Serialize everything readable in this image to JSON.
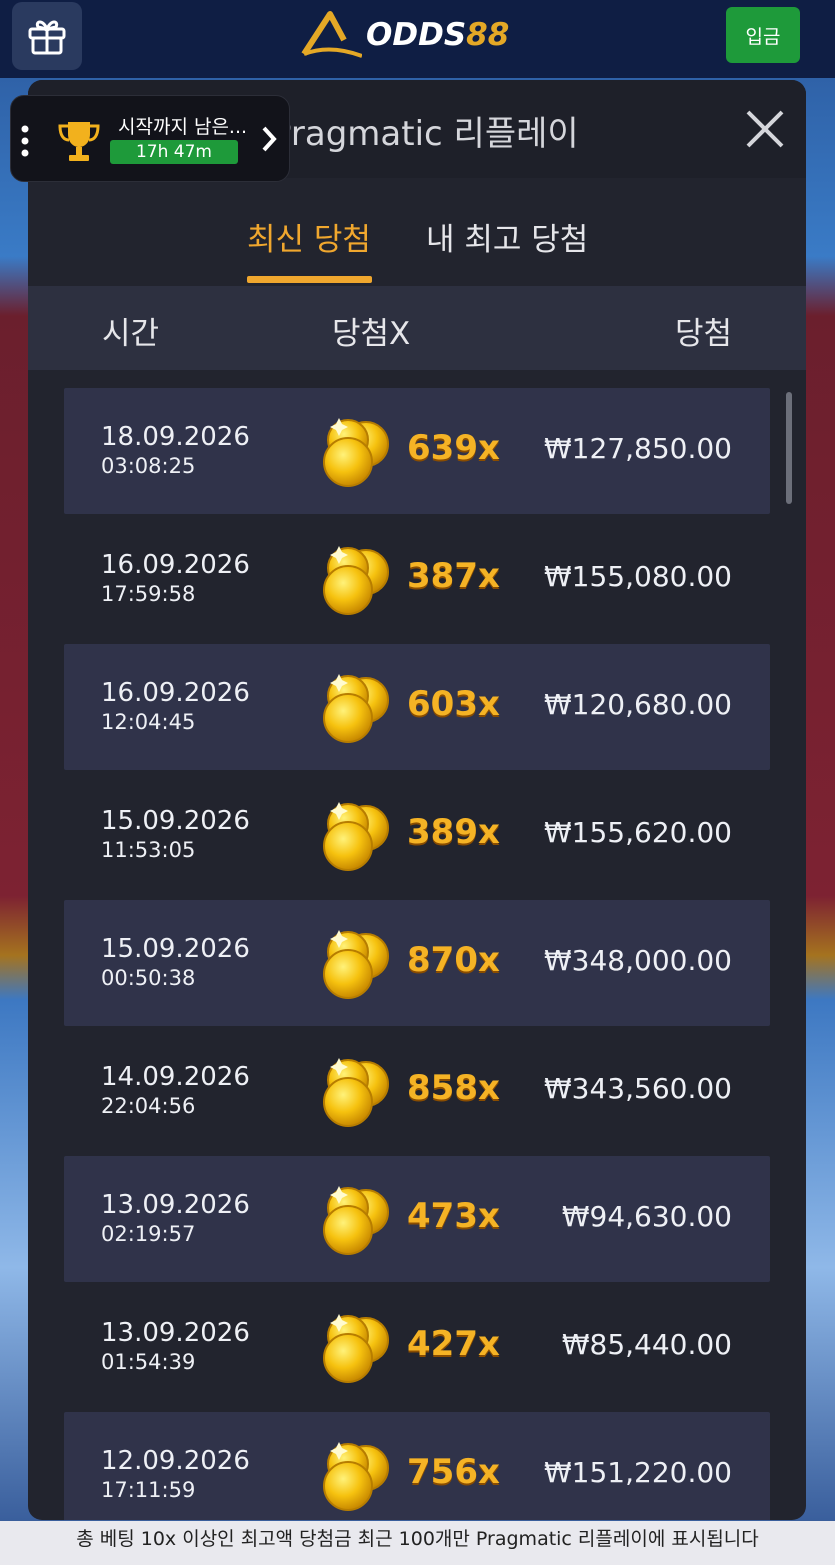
{
  "topbar": {
    "logo_text": "ODDS",
    "logo_num": "88",
    "deposit_label": "입금"
  },
  "widget": {
    "title": "시작까지 남은...",
    "timer": "17h 47m"
  },
  "modal": {
    "title": "Pragmatic 리플레이",
    "tabs": [
      "최신 당첨",
      "내 최고 당첨"
    ],
    "active_tab": "최신 당첨",
    "columns": [
      "시간",
      "당첨X",
      "당첨"
    ],
    "rows": [
      {
        "date": "18.09.2026",
        "time": "03:08:25",
        "multiplier": "639x",
        "amount": "₩127,850.00"
      },
      {
        "date": "16.09.2026",
        "time": "17:59:58",
        "multiplier": "387x",
        "amount": "₩155,080.00"
      },
      {
        "date": "16.09.2026",
        "time": "12:04:45",
        "multiplier": "603x",
        "amount": "₩120,680.00"
      },
      {
        "date": "15.09.2026",
        "time": "11:53:05",
        "multiplier": "389x",
        "amount": "₩155,620.00"
      },
      {
        "date": "15.09.2026",
        "time": "00:50:38",
        "multiplier": "870x",
        "amount": "₩348,000.00"
      },
      {
        "date": "14.09.2026",
        "time": "22:04:56",
        "multiplier": "858x",
        "amount": "₩343,560.00"
      },
      {
        "date": "13.09.2026",
        "time": "02:19:57",
        "multiplier": "473x",
        "amount": "₩94,630.00"
      },
      {
        "date": "13.09.2026",
        "time": "01:54:39",
        "multiplier": "427x",
        "amount": "₩85,440.00"
      },
      {
        "date": "12.09.2026",
        "time": "17:11:59",
        "multiplier": "756x",
        "amount": "₩151,220.00"
      }
    ]
  },
  "footer": {
    "text": "총 베팅 10x 이상인 최고액 당첨금 최근 100개만 Pragmatic 리플레이에 표시됩니다"
  },
  "colors": {
    "accent": "#f0a72e",
    "deposit_green": "#1e9a3a",
    "modal_bg": "#22242e",
    "row_alt_bg": "#30334a"
  }
}
